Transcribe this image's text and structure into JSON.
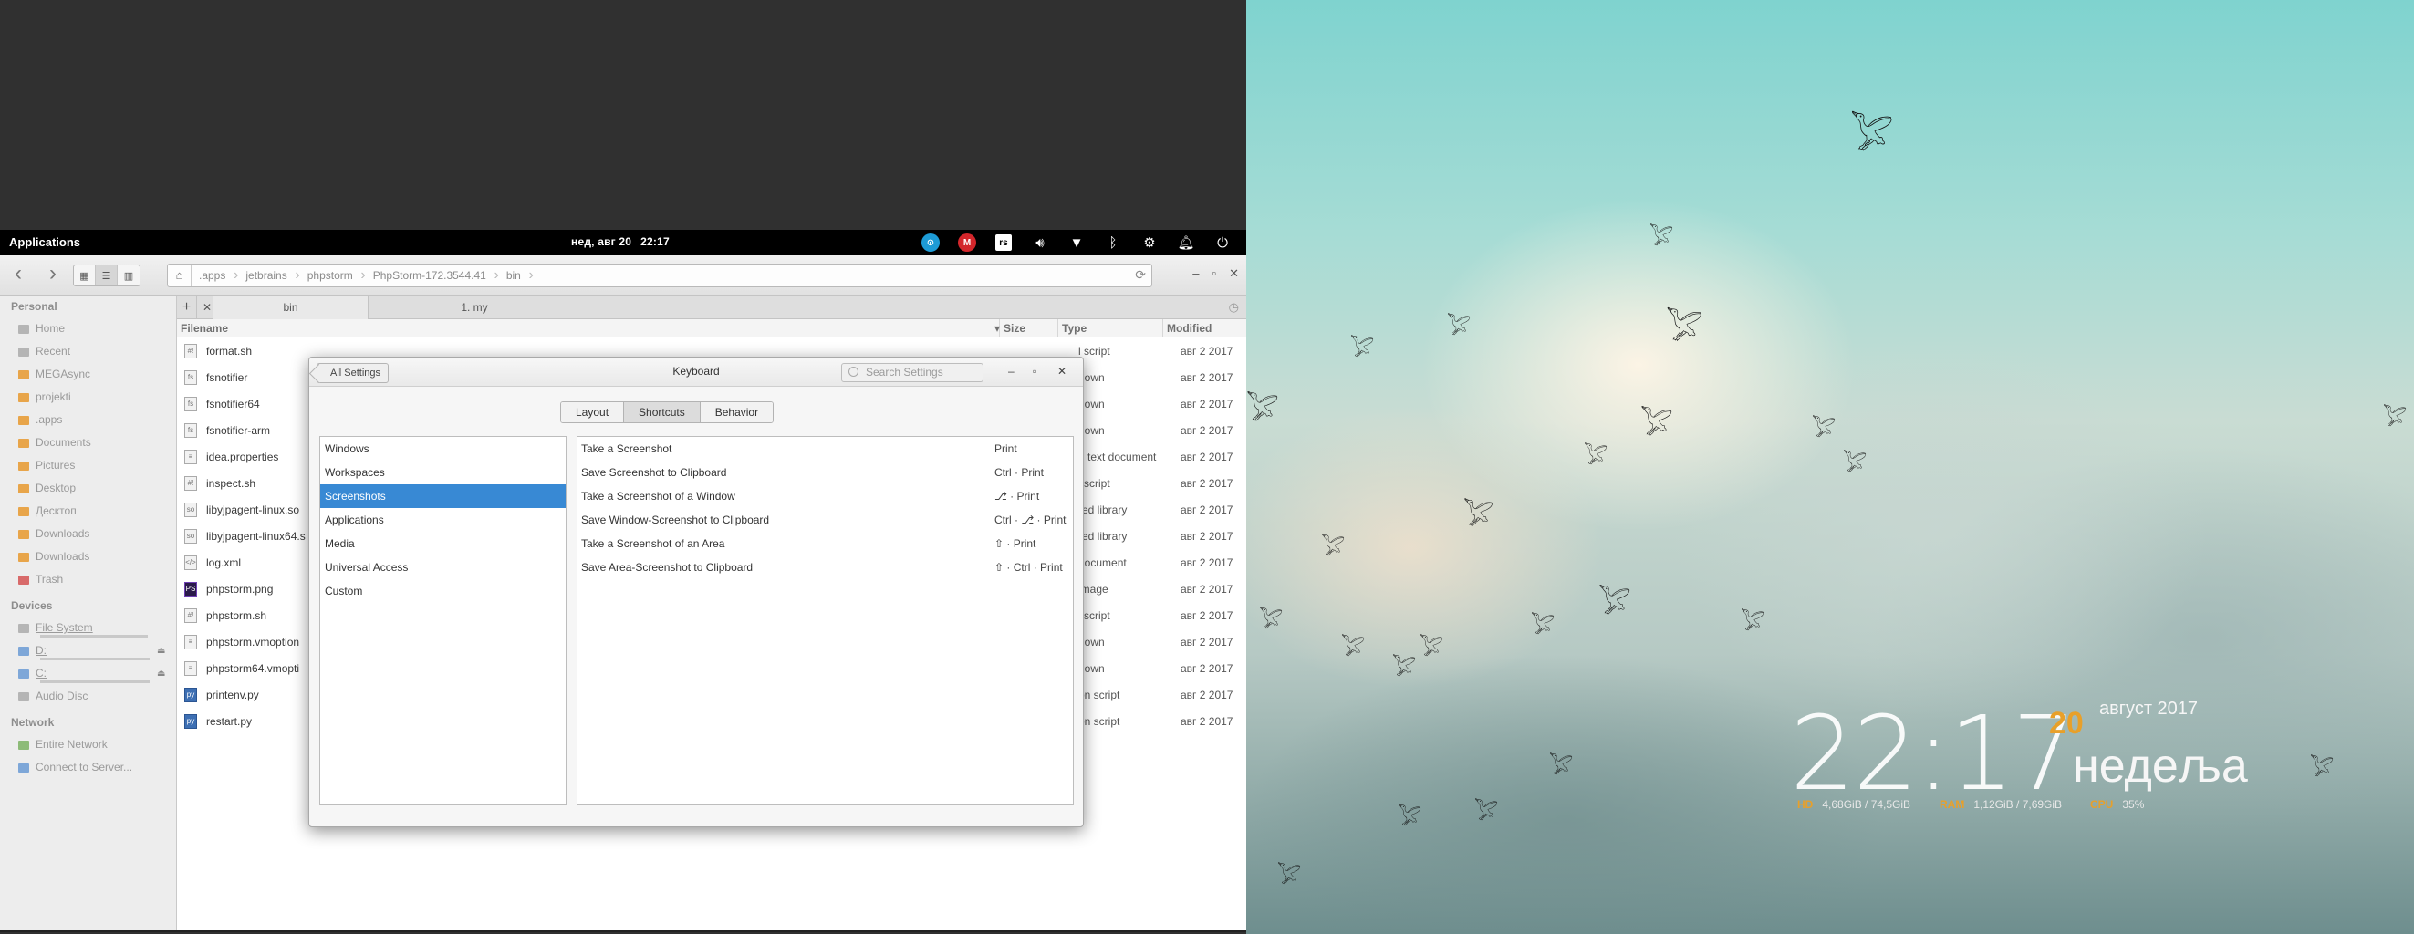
{
  "panel": {
    "applications": "Applications",
    "date": "нед, авг 20",
    "time": "22:17",
    "tray": [
      "network-icon",
      "mega-sync-icon",
      "rs-icon",
      "volume-icon",
      "wifi-icon",
      "bluetooth-icon",
      "settings-icon",
      "notifications-icon",
      "power-icon"
    ]
  },
  "files": {
    "breadcrumbs": [
      ".apps",
      "jetbrains",
      "phpstorm",
      "PhpStorm-172.3544.41",
      "bin"
    ],
    "tabs": [
      "bin",
      "1. my"
    ],
    "columns": [
      "Filename",
      "Size",
      "Type",
      "Modified"
    ],
    "sidebar": {
      "personal_header": "Personal",
      "personal": [
        {
          "label": "Home",
          "icon": "home-icon"
        },
        {
          "label": "Recent",
          "icon": "recent-icon"
        },
        {
          "label": "MEGAsync",
          "icon": "folder-icon"
        },
        {
          "label": "projekti",
          "icon": "folder-icon"
        },
        {
          "label": ".apps",
          "icon": "folder-icon"
        },
        {
          "label": "Documents",
          "icon": "folder-icon"
        },
        {
          "label": "Pictures",
          "icon": "folder-icon"
        },
        {
          "label": "Desktop",
          "icon": "folder-icon"
        },
        {
          "label": "Десктоп",
          "icon": "folder-icon"
        },
        {
          "label": "Downloads",
          "icon": "folder-icon"
        },
        {
          "label": "Downloads",
          "icon": "folder-icon"
        },
        {
          "label": "Trash",
          "icon": "trash-icon"
        }
      ],
      "devices_header": "Devices",
      "devices": [
        {
          "label": "File System",
          "icon": "drive-icon"
        },
        {
          "label": "D:",
          "icon": "drive-icon"
        },
        {
          "label": "C:",
          "icon": "drive-icon"
        },
        {
          "label": "Audio Disc",
          "icon": "disc-icon"
        }
      ],
      "network_header": "Network",
      "network": [
        {
          "label": "Entire Network",
          "icon": "network-icon"
        },
        {
          "label": "Connect to Server...",
          "icon": "server-icon"
        }
      ]
    },
    "rows": [
      {
        "name": "format.sh",
        "type": "l script",
        "date": "авг  2 2017",
        "icon": "sh"
      },
      {
        "name": "fsnotifier",
        "type": "nown",
        "date": "авг  2 2017",
        "icon": "bin"
      },
      {
        "name": "fsnotifier64",
        "type": "nown",
        "date": "авг  2 2017",
        "icon": "bin"
      },
      {
        "name": "fsnotifier-arm",
        "type": "nown",
        "date": "авг  2 2017",
        "icon": "bin"
      },
      {
        "name": "idea.properties",
        "type": "n text document",
        "date": "авг  2 2017",
        "icon": "txt"
      },
      {
        "name": "inspect.sh",
        "type": "l script",
        "date": "авг  2 2017",
        "icon": "sh"
      },
      {
        "name": "libyjpagent-linux.so",
        "type": "red library",
        "date": "авг  2 2017",
        "icon": "so"
      },
      {
        "name": "libyjpagent-linux64.s",
        "type": "red library",
        "date": "авг  2 2017",
        "icon": "so"
      },
      {
        "name": "log.xml",
        "type": "document",
        "date": "авг  2 2017",
        "icon": "xml"
      },
      {
        "name": "phpstorm.png",
        "type": "image",
        "date": "авг  2 2017",
        "icon": "img"
      },
      {
        "name": "phpstorm.sh",
        "type": "l script",
        "date": "авг  2 2017",
        "icon": "sh"
      },
      {
        "name": "phpstorm.vmoption",
        "type": "nown",
        "date": "авг  2 2017",
        "icon": "bin"
      },
      {
        "name": "phpstorm64.vmopti",
        "type": "nown",
        "date": "авг  2 2017",
        "icon": "bin"
      },
      {
        "name": "printenv.py",
        "type": "on script",
        "date": "авг  2 2017",
        "icon": "py"
      },
      {
        "name": "restart.py",
        "type": "on script",
        "date": "авг  2 2017",
        "icon": "py"
      }
    ]
  },
  "keyboard": {
    "back": "All Settings",
    "title": "Keyboard",
    "search_placeholder": "Search Settings",
    "modes": [
      "Layout",
      "Shortcuts",
      "Behavior"
    ],
    "active_mode": "Shortcuts",
    "categories": [
      "Windows",
      "Workspaces",
      "Screenshots",
      "Applications",
      "Media",
      "Universal Access",
      "Custom"
    ],
    "selected_category": "Screenshots",
    "shortcuts": [
      {
        "action": "Take a Screenshot",
        "keys": "Print"
      },
      {
        "action": "Save Screenshot to Clipboard",
        "keys": "Ctrl · Print"
      },
      {
        "action": "Take a Screenshot of a Window",
        "keys": "⎇ · Print"
      },
      {
        "action": "Save Window-Screenshot to Clipboard",
        "keys": "Ctrl · ⎇ · Print"
      },
      {
        "action": "Take a Screenshot of an Area",
        "keys": "⇧ · Print"
      },
      {
        "action": "Save Area-Screenshot to Clipboard",
        "keys": "⇧ · Ctrl · Print"
      }
    ]
  },
  "conky": {
    "time": "22:17",
    "day": "20",
    "month_year": "август 2017",
    "weekday": "недеља",
    "hd_label": "HD",
    "hd_value": "4,68GiB / 74,5GiB",
    "ram_label": "RAM",
    "ram_value": "1,12GiB / 7,69GiB",
    "cpu_label": "CPU",
    "cpu_value": "35%"
  },
  "colors": {
    "selection": "#3889d4",
    "conky_accent": "#e8a02a",
    "panel": "#000000"
  }
}
